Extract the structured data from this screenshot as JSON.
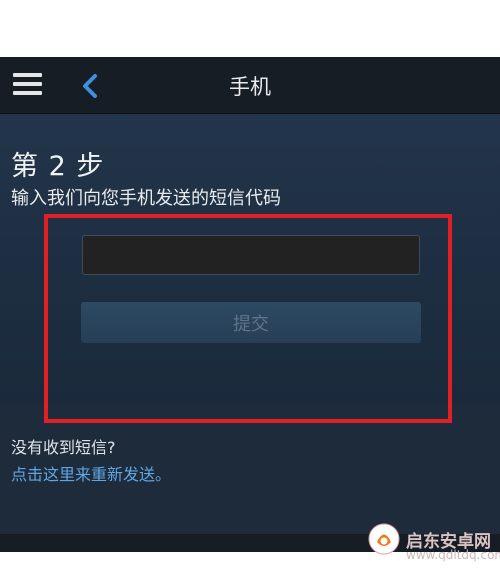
{
  "header": {
    "title": "手机",
    "menu_icon": "hamburger-menu-icon",
    "back_icon": "chevron-left-icon"
  },
  "step": {
    "title": "第 2 步",
    "description": "输入我们向您手机发送的短信代码"
  },
  "form": {
    "code_value": "",
    "submit_label": "提交"
  },
  "footer": {
    "no_sms_text": "没有收到短信?",
    "resend_link_text": "点击这里来重新发送。"
  },
  "watermark": {
    "title": "启东安卓网",
    "url": "www.qdltdq.com"
  },
  "colors": {
    "background": "#1b2838",
    "navbar": "#171d25",
    "highlight_border": "#e02024",
    "link": "#5fa6e3",
    "back_chevron": "#3d8fe0"
  }
}
